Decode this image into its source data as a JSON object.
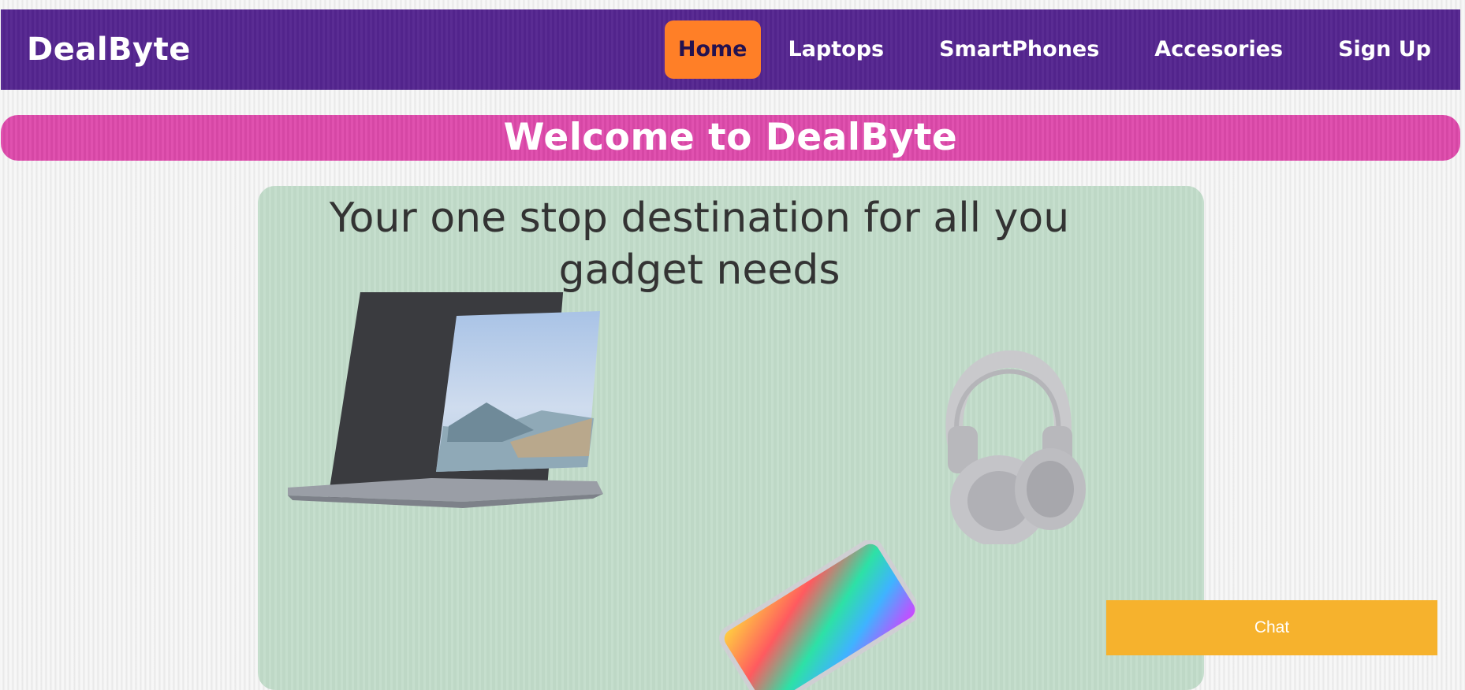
{
  "navbar": {
    "brand": "DealByte",
    "items": [
      {
        "label": "Home",
        "active": true
      },
      {
        "label": "Laptops"
      },
      {
        "label": "SmartPhones"
      },
      {
        "label": "Accesories"
      },
      {
        "label": "Sign Up"
      }
    ]
  },
  "banner": {
    "title": "Welcome to DealByte"
  },
  "hero": {
    "tagline_line1": "Your one stop destination for all you",
    "tagline_line2": "gadget needs"
  },
  "chat": {
    "label": "Chat"
  },
  "colors": {
    "navbar": "#552590",
    "active_tab": "#ff7f27",
    "banner": "#df4aac",
    "hero_bg": "#c2dcca",
    "chat_button": "#f6b22d"
  }
}
